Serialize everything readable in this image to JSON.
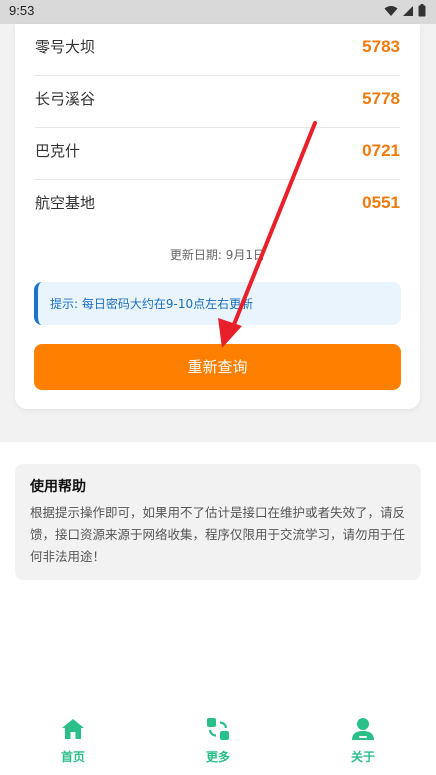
{
  "status_bar": {
    "time": "9:53"
  },
  "codes": [
    {
      "name": "零号大坝",
      "code": "5783"
    },
    {
      "name": "长弓溪谷",
      "code": "5778"
    },
    {
      "name": "巴克什",
      "code": "0721"
    },
    {
      "name": "航空基地",
      "code": "0551"
    }
  ],
  "update_date": "更新日期: 9月1日",
  "tip": "提示: 每日密码大约在9-10点左右更新",
  "requery_button": "重新查询",
  "help": {
    "title": "使用帮助",
    "text": "根据提示操作即可，如果用不了估计是接口在维护或者失效了，请反馈，接口资源来源于网络收集，程序仅限用于交流学习，请勿用于任何非法用途！"
  },
  "nav": [
    {
      "label": "首页",
      "icon": "home-icon"
    },
    {
      "label": "更多",
      "icon": "more-icon"
    },
    {
      "label": "关于",
      "icon": "user-icon"
    }
  ],
  "colors": {
    "accent": "#ff7f00",
    "code": "#f07a0c",
    "tip_border": "#1b74c9",
    "nav": "#2bbf8a",
    "annotation_arrow": "#e8202a"
  }
}
